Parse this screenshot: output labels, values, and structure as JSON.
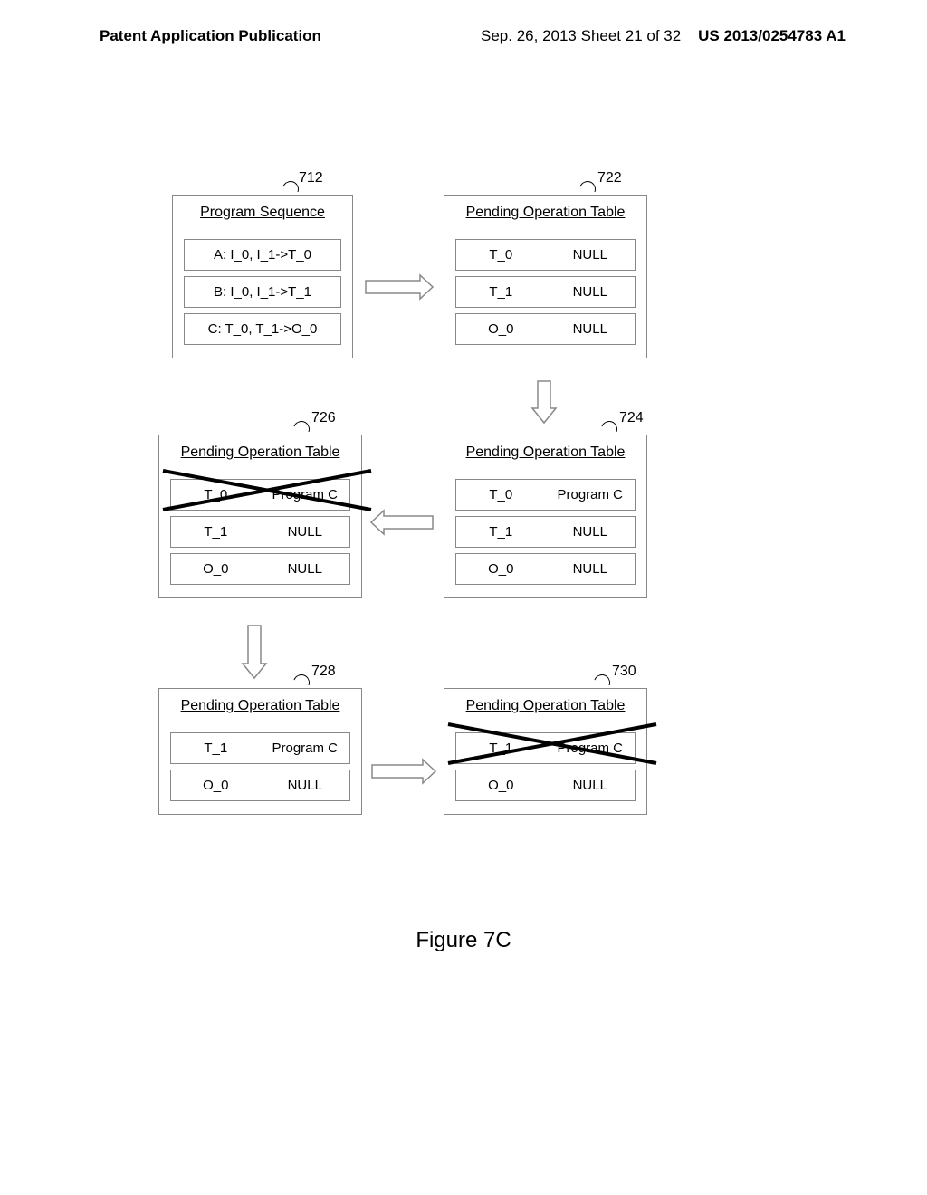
{
  "header": {
    "left": "Patent Application Publication",
    "center": "Sep. 26, 2013  Sheet 21 of 32",
    "right": "US 2013/0254783 A1"
  },
  "labels": {
    "l712": "712",
    "l722": "722",
    "l726": "726",
    "l724": "724",
    "l728": "728",
    "l730": "730"
  },
  "box712": {
    "title": "Program Sequence",
    "rows": [
      "A: I_0, I_1->T_0",
      "B: I_0, I_1->T_1",
      "C: T_0, T_1->O_0"
    ]
  },
  "box722": {
    "title": "Pending Operation Table",
    "rows": [
      {
        "k": "T_0",
        "v": "NULL"
      },
      {
        "k": "T_1",
        "v": "NULL"
      },
      {
        "k": "O_0",
        "v": "NULL"
      }
    ]
  },
  "box724": {
    "title": "Pending Operation Table",
    "rows": [
      {
        "k": "T_0",
        "v": "Program C"
      },
      {
        "k": "T_1",
        "v": "NULL"
      },
      {
        "k": "O_0",
        "v": "NULL"
      }
    ]
  },
  "box726": {
    "title": "Pending Operation Table",
    "rows": [
      {
        "k": "T_0",
        "v": "Program C"
      },
      {
        "k": "T_1",
        "v": "NULL"
      },
      {
        "k": "O_0",
        "v": "NULL"
      }
    ]
  },
  "box728": {
    "title": "Pending Operation Table",
    "rows": [
      {
        "k": "T_1",
        "v": "Program C"
      },
      {
        "k": "O_0",
        "v": "NULL"
      }
    ]
  },
  "box730": {
    "title": "Pending Operation Table",
    "rows": [
      {
        "k": "T_1",
        "v": "Program C"
      },
      {
        "k": "O_0",
        "v": "NULL"
      }
    ]
  },
  "figure_caption": "Figure 7C"
}
